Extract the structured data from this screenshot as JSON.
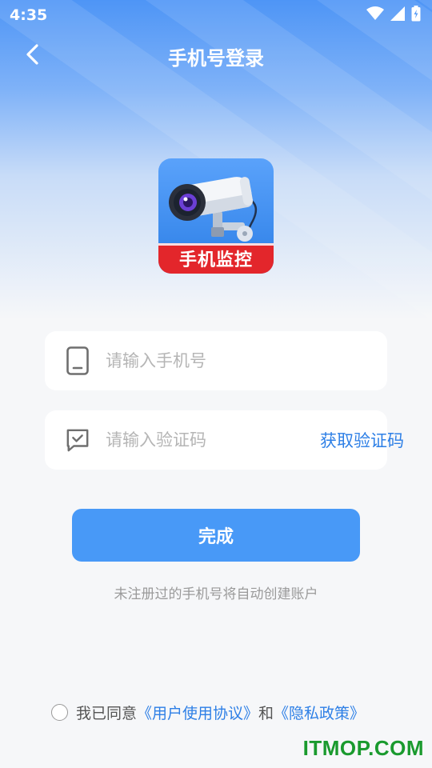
{
  "status_bar": {
    "time": "4:35",
    "icons": [
      "wifi-icon",
      "signal-icon",
      "battery-charging-icon"
    ]
  },
  "header": {
    "back_icon": "chevron-left-icon",
    "title": "手机号登录"
  },
  "app_logo": {
    "banner_text": "手机监控",
    "icon": "security-camera-icon"
  },
  "phone_input": {
    "icon": "phone-icon",
    "placeholder": "请输入手机号",
    "value": ""
  },
  "code_input": {
    "icon": "message-check-icon",
    "placeholder": "请输入验证码",
    "value": "",
    "get_code_label": "获取验证码"
  },
  "submit_label": "完成",
  "hint": "未注册过的手机号将自动创建账户",
  "agreement": {
    "checked": false,
    "prefix": "我已同意",
    "user_agreement": "《用户使用协议》",
    "conjunction": "和",
    "privacy_policy": "《隐私政策》"
  },
  "watermark": "ITMOP.COM",
  "colors": {
    "accent": "#4899f7",
    "link": "#2d7fe6",
    "header_gradient_top": "#4e95f6",
    "logo_banner": "#e3262b",
    "watermark": "#1a9a2e"
  }
}
